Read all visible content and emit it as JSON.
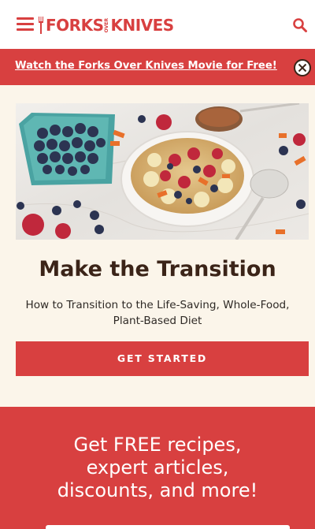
{
  "header": {
    "logo_text_1": "FORKS",
    "logo_text_over": "OVER",
    "logo_text_2": "KNIVES",
    "menu_icon": "hamburger-menu-icon",
    "search_icon": "search-icon"
  },
  "banner": {
    "link_text": "Watch the Forks Over Knives Movie for Free!",
    "close_icon": "close-circle-icon"
  },
  "hero": {
    "image_description_icon": "oatmeal-bowl-image"
  },
  "main": {
    "title": "Make the Transition",
    "subtitle": "How to Transition to the Life-Saving, Whole-Food, Plant-Based Diet",
    "cta_label": "GET STARTED"
  },
  "promo": {
    "text": "Get FREE recipes,\nexpert articles,\ndiscounts, and more!"
  },
  "colors": {
    "brand_red": "#d84040",
    "page_bg": "#fbf5ea",
    "title_brown": "#3b2418"
  }
}
